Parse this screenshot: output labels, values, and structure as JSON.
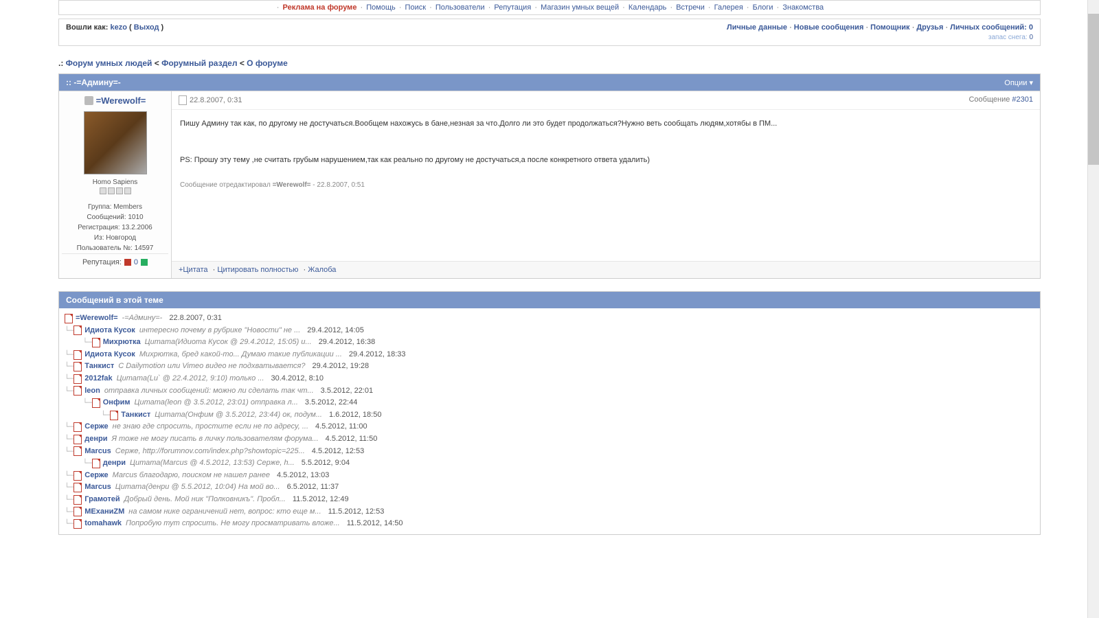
{
  "nav": {
    "items": [
      {
        "label": "Реклама на форуме",
        "hl": true
      },
      {
        "label": "Помощь"
      },
      {
        "label": "Поиск"
      },
      {
        "label": "Пользователи"
      },
      {
        "label": "Репутация"
      },
      {
        "label": "Магазин умных вещей"
      },
      {
        "label": "Календарь"
      },
      {
        "label": "Встречи"
      },
      {
        "label": "Галерея"
      },
      {
        "label": "Блоги"
      },
      {
        "label": "Знакомства"
      }
    ]
  },
  "userbar": {
    "logged_as_prefix": "Вошли как: ",
    "username": "kezo",
    "logout_open": " ( ",
    "logout": "Выход",
    "logout_close": " )",
    "right_links": [
      "Личные данные",
      "Новые сообщения",
      "Помощник",
      "Друзья",
      "Личных сообщений: 0"
    ],
    "snow_label": "запас снега: ",
    "snow_value": "0"
  },
  "breadcrumb": {
    "prefix": ".: ",
    "forum": "Форум умных людей",
    "section": "Форумный раздел",
    "topic": "О форуме",
    "sep": " < "
  },
  "topic": {
    "prefix": ":: ",
    "title": "-=Админу=-",
    "options": "Опции"
  },
  "post": {
    "author": "=Werewolf=",
    "date": "22.8.2007, 0:31",
    "msg_label": "Сообщение ",
    "msg_num": "#2301",
    "rank": "Homo Sapiens",
    "info": {
      "group": "Группа: Members",
      "posts": "Сообщений: 1010",
      "reg": "Регистрация: 13.2.2006",
      "from": "Из: Новгород",
      "uid": "Пользователь №: 14597"
    },
    "rep_label": "Репутация:",
    "rep_value": "0",
    "body_p1": "Пишу Админу так как, по другому не достучаться.Вообщем нахожусь в бане,незная за что.Долго ли это будет продолжаться?Нужно веть сообщать людям,хотябы в ПМ...",
    "body_p2": "PS: Прошу эту тему ,не считать грубым нарушением,так как реально по другому не достучаться,а после конкретного ответа удалить)",
    "edited_prefix": "Сообщение отредактировал ",
    "edited_by": "=Werewolf=",
    "edited_suffix": " - 22.8.2007, 0:51",
    "actions": {
      "quote": "+Цитата",
      "full_quote": "Цитировать полностью",
      "report": "Жалоба"
    }
  },
  "thread": {
    "title": "Сообщений в этой теме",
    "items": [
      {
        "depth": 0,
        "author": "=Werewolf=",
        "snippet": "-=Админу=-",
        "date": "22.8.2007, 0:31"
      },
      {
        "depth": 1,
        "author": "Идиота Кусок",
        "snippet": "интересно почему в рубрике \"Новости\" не ...",
        "date": "29.4.2012, 14:05"
      },
      {
        "depth": 2,
        "author": "Михрютка",
        "snippet": "Цитата(Идиота Кусок @ 29.4.2012, 15:05) и...",
        "date": "29.4.2012, 16:38"
      },
      {
        "depth": 1,
        "author": "Идиота Кусок",
        "snippet": "Михрютка, бред какой-то... Думаю такие публикации ...",
        "date": "29.4.2012, 18:33"
      },
      {
        "depth": 1,
        "author": "Танкист",
        "snippet": "С Dailymotion или Vimeo видео не подхватывается?",
        "date": "29.4.2012, 19:28"
      },
      {
        "depth": 1,
        "author": "2012fak",
        "snippet": "Цитата(Lu` @ 22.4.2012, 9:10) только ...",
        "date": "30.4.2012, 8:10"
      },
      {
        "depth": 1,
        "author": "leon",
        "snippet": "отправка личных сообщений: можно ли сделать так чт...",
        "date": "3.5.2012, 22:01"
      },
      {
        "depth": 2,
        "author": "Онфим",
        "snippet": "Цитата(leon @ 3.5.2012, 23:01) отправка л...",
        "date": "3.5.2012, 22:44"
      },
      {
        "depth": 3,
        "author": "Танкист",
        "snippet": "Цитата(Онфим @ 3.5.2012, 23:44) ок, подум...",
        "date": "1.6.2012, 18:50"
      },
      {
        "depth": 1,
        "author": "Серже",
        "snippet": "не знаю где спросить, простите если не по адресу, ...",
        "date": "4.5.2012, 11:00"
      },
      {
        "depth": 1,
        "author": "денри",
        "snippet": "Я тоже не могу писать в личку пользователям форума...",
        "date": "4.5.2012, 11:50"
      },
      {
        "depth": 1,
        "author": "Marcus",
        "snippet": "Серже, http://forumnov.com/index.php?showtopic=225...",
        "date": "4.5.2012, 12:53"
      },
      {
        "depth": 2,
        "author": "денри",
        "snippet": "Цитата(Marcus @ 4.5.2012, 13:53) Серже, h...",
        "date": "5.5.2012, 9:04"
      },
      {
        "depth": 1,
        "author": "Серже",
        "snippet": "Marcus благодарю, поиском не нашел ранее",
        "date": "4.5.2012, 13:03"
      },
      {
        "depth": 1,
        "author": "Marcus",
        "snippet": "Цитата(денри @ 5.5.2012, 10:04) На мой во...",
        "date": "6.5.2012, 11:37"
      },
      {
        "depth": 1,
        "author": "Грамотей",
        "snippet": "Добрый день. Мой ник \"Полковникъ\". Пробл...",
        "date": "11.5.2012, 12:49"
      },
      {
        "depth": 1,
        "author": "MEхaниZM",
        "snippet": "на самом нике ограничений нет, вопрос: кто еще м...",
        "date": "11.5.2012, 12:53"
      },
      {
        "depth": 1,
        "author": "tomahawk",
        "snippet": "Попробую тут спросить. Не могу просматривать вложе...",
        "date": "11.5.2012, 14:50"
      }
    ]
  }
}
